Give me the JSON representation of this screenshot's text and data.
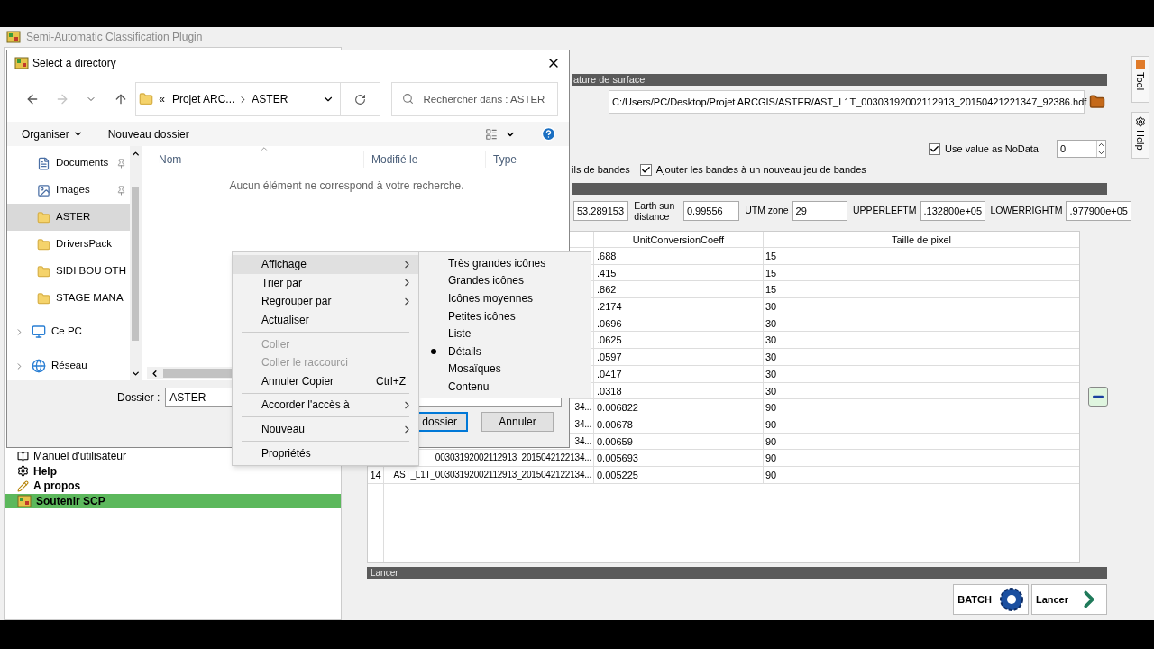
{
  "app": {
    "title": "Semi-Automatic Classification Plugin",
    "menu_tree": [
      {
        "label": "Manuel d'utilisateur",
        "kind": "manual",
        "selected": false
      },
      {
        "label": "Help",
        "kind": "help",
        "selected": false
      },
      {
        "label": "A propos",
        "kind": "about",
        "selected": false
      },
      {
        "label": "Soutenir SCP",
        "kind": "support",
        "selected": true
      }
    ],
    "section_title": "ature de surface",
    "file_path": "C:/Users/PC/Desktop/Projet ARCGIS/ASTER/AST_L1T_00303192002112913_20150421221347_92386.hdf",
    "nodata": {
      "label": "Use value as NoData",
      "checked": true,
      "value": "0"
    },
    "band_detail_text": "ils de bandes",
    "add_to_bandset": {
      "label": "Ajouter les bandes à un nouveau jeu de bandes",
      "checked": true
    },
    "metadata_fields": [
      {
        "value": "53.289153"
      },
      {
        "label": "Earth sun distance",
        "value": "0.99556"
      },
      {
        "label": "UTM zone",
        "value": "29"
      },
      {
        "label": "UPPERLEFTM",
        "value": ".132800e+05"
      },
      {
        "label": "LOWERRIGHTM",
        "value": ".977900e+05"
      }
    ],
    "table": {
      "columns": [
        "UnitConversionCoeff",
        "Taille de pixel"
      ],
      "rows": [
        {
          "coeff": ".688",
          "pixel_size": "15"
        },
        {
          "coeff": ".415",
          "pixel_size": "15"
        },
        {
          "coeff": ".862",
          "pixel_size": "15"
        },
        {
          "coeff": ".2174",
          "pixel_size": "30"
        },
        {
          "coeff": ".0696",
          "pixel_size": "30"
        },
        {
          "coeff": ".0625",
          "pixel_size": "30"
        },
        {
          "coeff": ".0597",
          "pixel_size": "30"
        },
        {
          "coeff": ".0417",
          "pixel_size": "30"
        },
        {
          "coeff": ".0318",
          "pixel_size": "30"
        },
        {
          "band": "34...",
          "coeff": "0.006822",
          "pixel_size": "90"
        },
        {
          "band": "34...",
          "coeff": "0.00678",
          "pixel_size": "90"
        },
        {
          "band": "34...",
          "coeff": "0.00659",
          "pixel_size": "90"
        },
        {
          "band": "_00303192002112913_2015042122134...",
          "coeff": "0.005693",
          "pixel_size": "90"
        },
        {
          "number": "14",
          "band": "AST_L1T_00303192002112913_2015042122134...",
          "coeff": "0.005225",
          "pixel_size": "90"
        }
      ]
    },
    "run_section_title": "Lancer",
    "run_buttons": [
      {
        "label": "BATCH",
        "kind": "batch"
      },
      {
        "label": "Lancer",
        "kind": "run"
      }
    ],
    "side_tabs": [
      {
        "label": "Tool",
        "kind": "tool"
      },
      {
        "label": "Help",
        "kind": "help"
      }
    ]
  },
  "dialog": {
    "title": "Select a directory",
    "nav": [
      {
        "kind": "back",
        "disabled": false
      },
      {
        "kind": "forward",
        "disabled": true
      },
      {
        "kind": "recent",
        "disabled": false
      },
      {
        "kind": "up",
        "disabled": false
      }
    ],
    "address": {
      "overflow": "«",
      "segments": [
        "Projet ARC...",
        "ASTER"
      ]
    },
    "search": {
      "placeholder": "Rechercher dans : ASTER"
    },
    "toolbar": {
      "organize": "Organiser",
      "new_folder": "Nouveau dossier"
    },
    "nav_pane": [
      {
        "label": "Documents",
        "kind": "documents",
        "pinned": true,
        "has_children": false,
        "selected": false
      },
      {
        "label": "Images",
        "kind": "images",
        "pinned": true,
        "has_children": false,
        "selected": false
      },
      {
        "label": "ASTER",
        "kind": "folder",
        "pinned": false,
        "has_children": false,
        "selected": true
      },
      {
        "label": "DriversPack",
        "kind": "folder",
        "pinned": false,
        "has_children": false,
        "selected": false
      },
      {
        "label": "SIDI BOU OTH",
        "kind": "folder",
        "pinned": false,
        "has_children": false,
        "selected": false
      },
      {
        "label": "STAGE MANA",
        "kind": "folder",
        "pinned": false,
        "has_children": false,
        "selected": false
      },
      {
        "label": "Ce PC",
        "kind": "pc",
        "pinned": false,
        "has_children": true,
        "selected": false
      },
      {
        "label": "Réseau",
        "kind": "network",
        "pinned": false,
        "has_children": true,
        "selected": false
      }
    ],
    "columns": [
      "Nom",
      "Modifié le",
      "Type"
    ],
    "empty_message": "Aucun élément ne correspond à votre recherche.",
    "folder_label": "Dossier :",
    "folder_value": "ASTER",
    "buttons": [
      {
        "label": "dossier",
        "default": true
      },
      {
        "label": "Annuler",
        "default": false
      }
    ]
  },
  "context_menu": {
    "items": [
      {
        "kind": "item",
        "label": "Affichage",
        "submenu": true,
        "disabled": false,
        "highlighted": true
      },
      {
        "kind": "item",
        "label": "Trier par",
        "submenu": true,
        "disabled": false,
        "highlighted": false
      },
      {
        "kind": "item",
        "label": "Regrouper par",
        "submenu": true,
        "disabled": false,
        "highlighted": false
      },
      {
        "kind": "item",
        "label": "Actualiser",
        "submenu": false,
        "disabled": false,
        "highlighted": false
      },
      {
        "kind": "separator"
      },
      {
        "kind": "item",
        "label": "Coller",
        "submenu": false,
        "disabled": true,
        "highlighted": false
      },
      {
        "kind": "item",
        "label": "Coller le raccourci",
        "submenu": false,
        "disabled": true,
        "highlighted": false
      },
      {
        "kind": "item",
        "label": "Annuler Copier",
        "shortcut": "Ctrl+Z",
        "submenu": false,
        "disabled": false,
        "highlighted": false
      },
      {
        "kind": "separator"
      },
      {
        "kind": "item",
        "label": "Accorder l'accès à",
        "submenu": true,
        "disabled": false,
        "highlighted": false
      },
      {
        "kind": "separator"
      },
      {
        "kind": "item",
        "label": "Nouveau",
        "submenu": true,
        "disabled": false,
        "highlighted": false
      },
      {
        "kind": "separator"
      },
      {
        "kind": "item",
        "label": "Propriétés",
        "submenu": false,
        "disabled": false,
        "highlighted": false
      }
    ]
  },
  "submenu": {
    "items": [
      {
        "label": "Très grandes icônes",
        "selected": false
      },
      {
        "label": "Grandes icônes",
        "selected": false
      },
      {
        "label": "Icônes moyennes",
        "selected": false
      },
      {
        "label": "Petites icônes",
        "selected": false
      },
      {
        "label": "Liste",
        "selected": false
      },
      {
        "label": "Détails",
        "selected": true
      },
      {
        "label": "Mosaïques",
        "selected": false
      },
      {
        "label": "Contenu",
        "selected": false
      }
    ]
  }
}
